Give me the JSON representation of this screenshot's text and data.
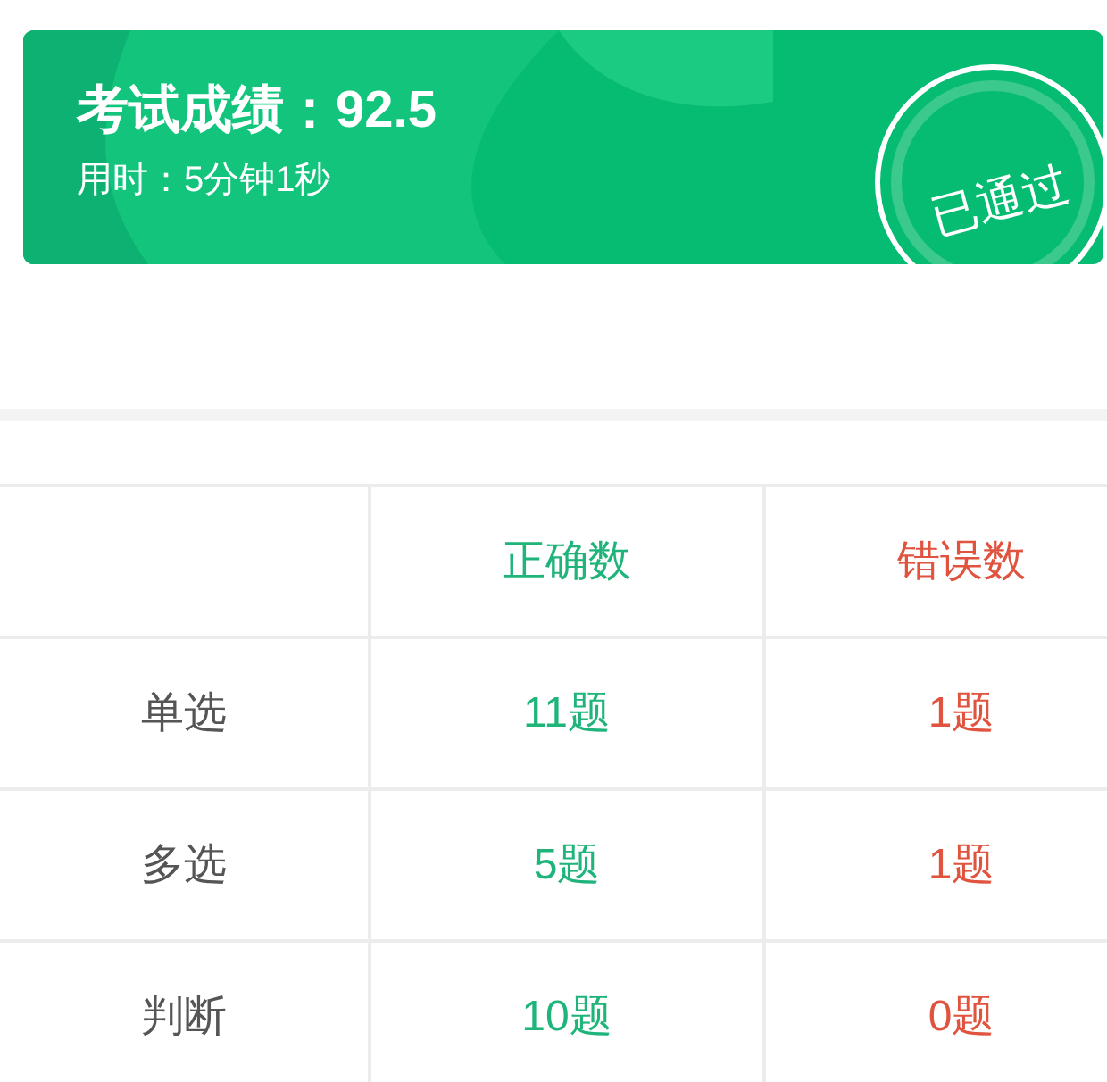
{
  "result": {
    "title": "考试成绩：92.5",
    "duration": "用时：5分钟1秒",
    "stamp": "已通过"
  },
  "table": {
    "columns": [
      {
        "label": "正确数",
        "kind": "correct"
      },
      {
        "label": "错误数",
        "kind": "wrong"
      }
    ],
    "rows": [
      {
        "label": "单选",
        "cells": [
          "11题",
          "1题"
        ]
      },
      {
        "label": "多选",
        "cells": [
          "5题",
          "1题"
        ]
      },
      {
        "label": "判断",
        "cells": [
          "10题",
          "0题"
        ]
      }
    ]
  }
}
